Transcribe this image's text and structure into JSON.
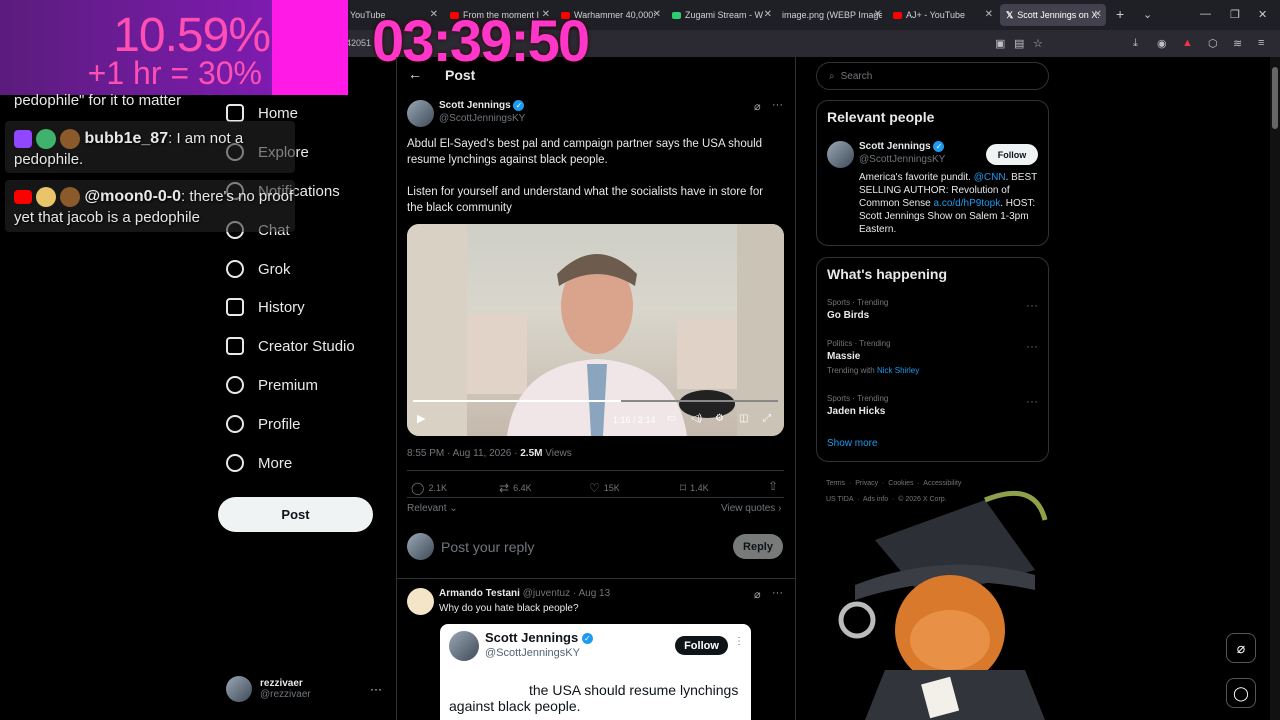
{
  "browser": {
    "tabs": [
      {
        "label": "YouTube",
        "color": "#ff0000"
      },
      {
        "label": "From the moment I",
        "color": "#ff0000"
      },
      {
        "label": "Warhammer 40,000:",
        "color": "#ff0000"
      },
      {
        "label": "Zugami Stream - W",
        "color": "#2ecc71"
      },
      {
        "label": "image.png (WEBP Image",
        "color": ""
      },
      {
        "label": "AJ+ - YouTube",
        "color": "#ff0000"
      },
      {
        "label": "Scott Jennings on X:",
        "color": "#ffffff"
      }
    ],
    "address_fragment": "42051"
  },
  "overlay": {
    "percent": "10.59%",
    "bonus": "+1 hr = 30%",
    "timer": "03:39:50",
    "chat": [
      {
        "user": "",
        "message": "pedophile\" for it to matter"
      },
      {
        "user": "bubb1e_87",
        "message": "I am not a pedophile."
      },
      {
        "user": "@moon0-0-0",
        "message": "there's no proof yet that jacob is a pedophile"
      }
    ]
  },
  "nav": {
    "items": [
      "Home",
      "Explore",
      "Notifications",
      "Chat",
      "Grok",
      "History",
      "Creator Studio",
      "Premium",
      "Profile",
      "More"
    ],
    "post_button": "Post",
    "account_name": "rezzivaer",
    "account_handle": "@rezzivaer"
  },
  "post": {
    "header": "Post",
    "author": "Scott Jennings",
    "handle": "@ScottJenningsKY",
    "text1": "Abdul El-Sayed's best pal and campaign partner says the USA should resume lynchings against black people.",
    "text2": "Listen for yourself and understand what the socialists have in store for the black community",
    "video_time": "1:16 / 2:14",
    "video_progress": 0.57,
    "timestamp": "8:55 PM · Aug 11, 2026 ·",
    "views_count": "2.5M",
    "views_label": "Views",
    "replies": "2.1K",
    "reposts": "6.4K",
    "likes": "15K",
    "bookmarks": "1.4K",
    "sort_label": "Relevant",
    "view_quotes": "View quotes",
    "reply_placeholder": "Post your reply",
    "reply_button": "Reply"
  },
  "reply": {
    "author": "Armando Testani",
    "handle": "@juventuz",
    "date": "· Aug 13",
    "text": "Why do you hate black people?",
    "quoted": {
      "author": "Scott Jennings",
      "handle": "@ScottJenningsKY",
      "follow": "Follow",
      "text": "the USA should resume lynchings against black people."
    }
  },
  "right": {
    "search_placeholder": "Search",
    "relevant_title": "Relevant people",
    "person": {
      "name": "Scott Jennings",
      "handle": "@ScottJenningsKY",
      "follow": "Follow",
      "bio1": "America's favorite pundit.",
      "bio_link1": "@CNN",
      "bio2": "BEST SELLING AUTHOR: Revolution of Common Sense",
      "bio_link2": "a.co/d/hP9topk",
      "bio3": "HOST: Scott Jennings Show on Salem 1-3pm Eastern."
    },
    "happening_title": "What's happening",
    "trends": [
      {
        "meta": "Sports · Trending",
        "name": "Go Birds",
        "extra": ""
      },
      {
        "meta": "Politics · Trending",
        "name": "Massie",
        "extra": "Trending with",
        "extra_link": "Nick Shirley"
      },
      {
        "meta": "Sports · Trending",
        "name": "Jaden Hicks",
        "extra": ""
      }
    ],
    "show_more": "Show more",
    "footer": [
      "Terms",
      "Privacy",
      "Cookies",
      "Accessibility",
      "US TIDA",
      "Ads info",
      "© 2026 X Corp."
    ]
  }
}
